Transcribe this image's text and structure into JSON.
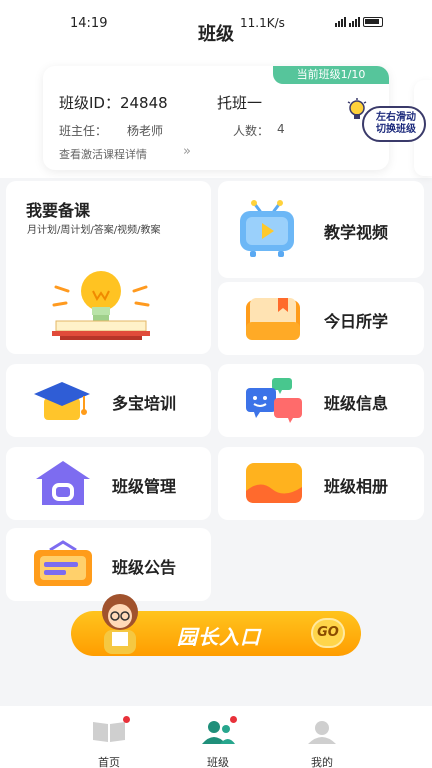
{
  "status_bar": {
    "time": "14:19",
    "network": "11.1K/s"
  },
  "header": {
    "title": "班级"
  },
  "class_card": {
    "badge": "当前班级1/10",
    "id_label": "班级ID：24848",
    "name": "托班一",
    "teacher_label": "班主任：",
    "teacher": "杨老师",
    "count_label": "人数：",
    "count": "4",
    "detail_link": "查看激活课程详情"
  },
  "swipe_hint": {
    "line1": "左右滑动",
    "line2": "切换班级"
  },
  "tiles": {
    "prep": {
      "title": "我要备课",
      "subtitle": "月计划/周计划/答案/视频/教案"
    },
    "video": {
      "label": "教学视频"
    },
    "today": {
      "label": "今日所学"
    },
    "training": {
      "label": "多宝培训"
    },
    "info": {
      "label": "班级信息"
    },
    "manage": {
      "label": "班级管理"
    },
    "album": {
      "label": "班级相册"
    },
    "notice": {
      "label": "班级公告"
    }
  },
  "banner": {
    "label": "园长入口",
    "go": "GO"
  },
  "bottom_nav": {
    "items": [
      {
        "label": "首页",
        "icon": "book-icon"
      },
      {
        "label": "班级",
        "icon": "class-icon"
      },
      {
        "label": "我的",
        "icon": "user-icon"
      }
    ]
  },
  "colors": {
    "accent_green": "#56c59b",
    "accent_orange": "#ffa800",
    "badge_red": "#e8313a"
  }
}
